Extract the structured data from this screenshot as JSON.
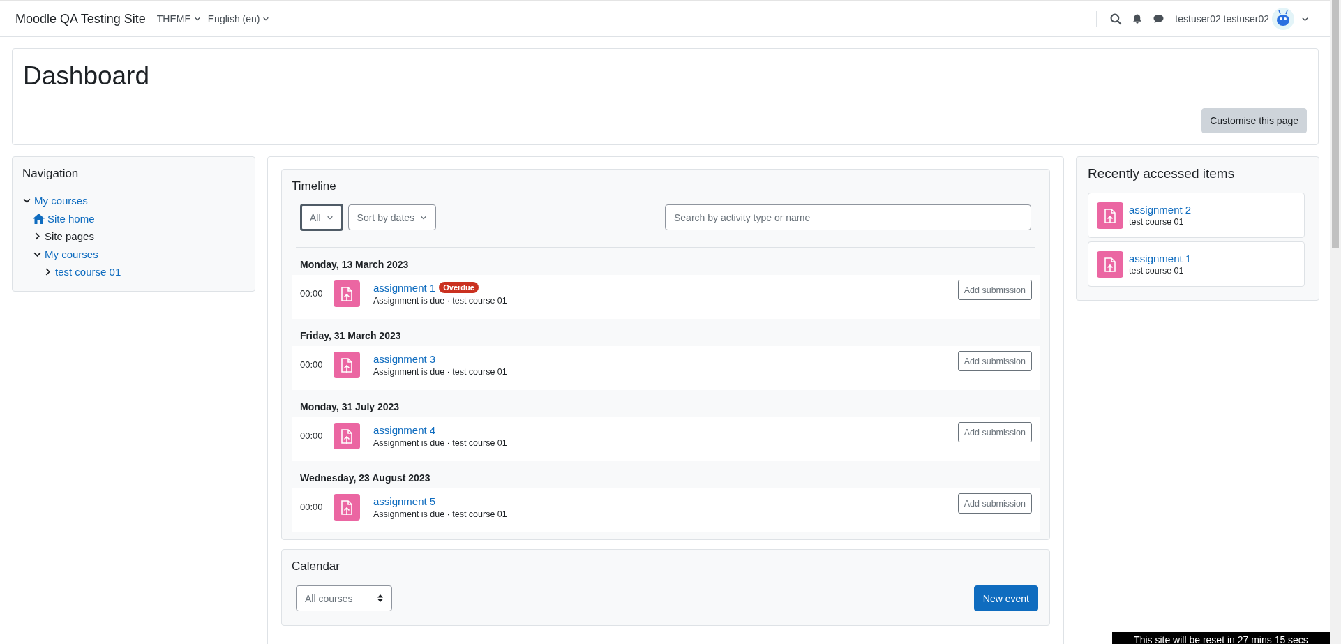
{
  "navbar": {
    "site_name": "Moodle QA Testing Site",
    "menus": [
      {
        "label": "THEME"
      },
      {
        "label": "English (en)"
      }
    ],
    "user_name": "testuser02 testuser02"
  },
  "header": {
    "title": "Dashboard",
    "button": "Customise this page"
  },
  "navigation": {
    "title": "Navigation",
    "items": [
      {
        "label": "My courses",
        "kind": "link",
        "expanded": true,
        "children": [
          {
            "label": "Site home",
            "kind": "home"
          },
          {
            "label": "Site pages",
            "kind": "plain",
            "expanded": false
          },
          {
            "label": "My courses",
            "kind": "link",
            "expanded": true,
            "children": [
              {
                "label": "test course 01",
                "kind": "link",
                "expanded": false
              }
            ]
          }
        ]
      }
    ]
  },
  "timeline": {
    "title": "Timeline",
    "filter": "All",
    "sort": "Sort by dates",
    "search_placeholder": "Search by activity type or name",
    "days": [
      {
        "date": "Monday, 13 March 2023",
        "events": [
          {
            "time": "00:00",
            "name": "assignment 1",
            "badge": "Overdue",
            "details": "Assignment is due · test course 01",
            "action": "Add submission"
          }
        ]
      },
      {
        "date": "Friday, 31 March 2023",
        "events": [
          {
            "time": "00:00",
            "name": "assignment 3",
            "details": "Assignment is due · test course 01",
            "action": "Add submission"
          }
        ]
      },
      {
        "date": "Monday, 31 July 2023",
        "events": [
          {
            "time": "00:00",
            "name": "assignment 4",
            "details": "Assignment is due · test course 01",
            "action": "Add submission"
          }
        ]
      },
      {
        "date": "Wednesday, 23 August 2023",
        "events": [
          {
            "time": "00:00",
            "name": "assignment 5",
            "details": "Assignment is due · test course 01",
            "action": "Add submission"
          }
        ]
      }
    ]
  },
  "recent": {
    "title": "Recently accessed items",
    "items": [
      {
        "name": "assignment 2",
        "course": "test course 01"
      },
      {
        "name": "assignment 1",
        "course": "test course 01"
      }
    ]
  },
  "calendar": {
    "title": "Calendar",
    "course_filter": "All courses",
    "button": "New event"
  },
  "reset_notice": "This site will be reset in 27 mins 15 secs"
}
